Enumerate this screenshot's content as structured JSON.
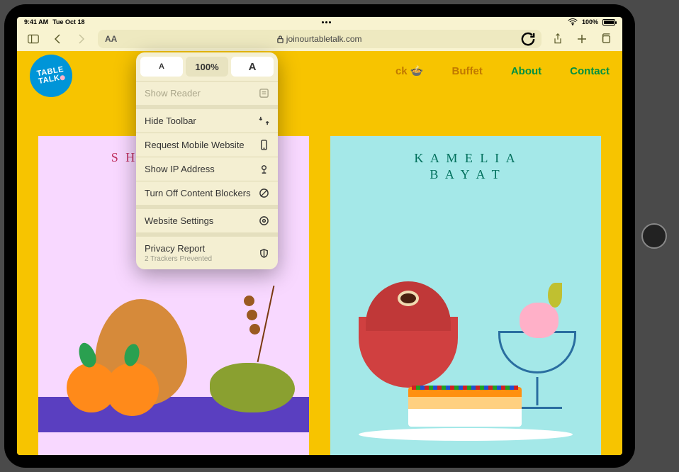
{
  "statusbar": {
    "time": "9:41 AM",
    "date": "Tue Oct 18",
    "battery_pct": "100%"
  },
  "toolbar": {
    "url": "joinourtabletalk.com",
    "aa_label": "AA"
  },
  "popover": {
    "zoom_smaller": "A",
    "zoom_value": "100%",
    "zoom_larger": "A",
    "show_reader": "Show Reader",
    "hide_toolbar": "Hide Toolbar",
    "request_mobile": "Request Mobile Website",
    "show_ip": "Show IP Address",
    "content_blockers": "Turn Off Content Blockers",
    "website_settings": "Website Settings",
    "privacy_report": "Privacy Report",
    "privacy_sub": "2 Trackers Prevented"
  },
  "site": {
    "logo_line1": "TABLE",
    "logo_line2": "TALK",
    "nav_potluck": "ck 🍲",
    "nav_buffet": "Buffet",
    "nav_about": "About",
    "nav_contact": "Contact",
    "card1_artist_visible": "S H",
    "card2_artist_line1": "K A M E L I A",
    "card2_artist_line2": "B A Y A T"
  }
}
